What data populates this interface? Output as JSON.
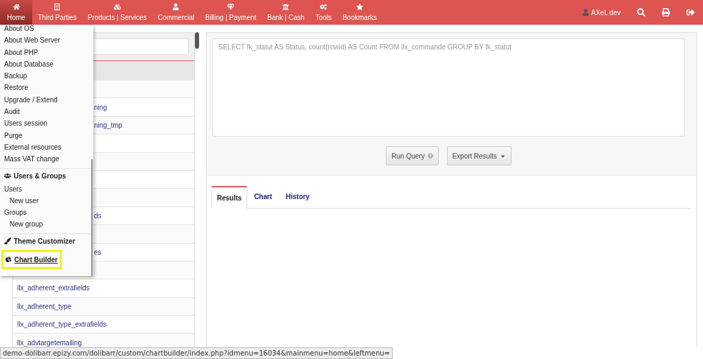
{
  "navbar": {
    "items": [
      {
        "label": "Home",
        "selected": true
      },
      {
        "label": "Third Parties",
        "selected": false
      },
      {
        "label": "Products | Services",
        "selected": false
      },
      {
        "label": "Commercial",
        "selected": false
      },
      {
        "label": "Billing | Payment",
        "selected": false
      },
      {
        "label": "Bank | Cash",
        "selected": false
      },
      {
        "label": "Tools",
        "selected": false
      },
      {
        "label": "Bookmarks",
        "selected": false
      }
    ],
    "user": "AXeL dev"
  },
  "home_menu": [
    {
      "kind": "item",
      "label": "About OS",
      "highlighted": false
    },
    {
      "kind": "item",
      "label": "About Web Server",
      "highlighted": false
    },
    {
      "kind": "item",
      "label": "About PHP",
      "highlighted": false
    },
    {
      "kind": "item",
      "label": "About Database",
      "highlighted": false
    },
    {
      "kind": "item",
      "label": "Backup",
      "highlighted": false
    },
    {
      "kind": "item",
      "label": "Restore",
      "highlighted": false
    },
    {
      "kind": "item",
      "label": "Upgrade / Extend",
      "highlighted": false
    },
    {
      "kind": "item",
      "label": "Audit",
      "highlighted": false
    },
    {
      "kind": "item",
      "label": "Users session",
      "highlighted": false
    },
    {
      "kind": "item",
      "label": "Purge",
      "highlighted": false
    },
    {
      "kind": "item",
      "label": "External resources",
      "highlighted": false
    },
    {
      "kind": "item",
      "label": "Mass VAT change",
      "highlighted": false
    },
    {
      "kind": "heading",
      "label": "Users & Groups",
      "highlighted": false
    },
    {
      "kind": "item",
      "label": "Users",
      "highlighted": false
    },
    {
      "kind": "subitem",
      "label": "New user",
      "highlighted": false
    },
    {
      "kind": "item",
      "label": "Groups",
      "highlighted": false
    },
    {
      "kind": "subitem",
      "label": "New group",
      "highlighted": false
    },
    {
      "kind": "heading",
      "label": "Theme Customizer",
      "highlighted": false
    },
    {
      "kind": "heading",
      "label": "Chart Builder",
      "highlighted": true
    }
  ],
  "tables_list": {
    "rows": [
      {
        "kind": "covered"
      },
      {
        "kind": "covered",
        "label": "ning"
      },
      {
        "kind": "covered",
        "label": "ning_tmp"
      },
      {
        "kind": "covered"
      },
      {
        "kind": "covered"
      },
      {
        "kind": "covered"
      },
      {
        "kind": "covered"
      },
      {
        "kind": "covered",
        "label": "ds"
      },
      {
        "kind": "covered"
      },
      {
        "kind": "covered",
        "label": "es"
      },
      {
        "kind": "covered"
      },
      {
        "kind": "full",
        "label": "llx_adherent_extrafields"
      },
      {
        "kind": "full",
        "label": "llx_adherent_type"
      },
      {
        "kind": "full",
        "label": "llx_adherent_type_extrafields"
      },
      {
        "kind": "full",
        "label": "llx_advtargetemailing"
      }
    ]
  },
  "query": {
    "placeholder": "SELECT fk_statut AS Status, count(rowid) AS Count FROM llx_commande GROUP BY fk_statut"
  },
  "buttons": {
    "run": "Run Query",
    "export": "Export Results"
  },
  "result_tabs": [
    {
      "label": "Results",
      "selected": true
    },
    {
      "label": "Chart",
      "selected": false
    },
    {
      "label": "History",
      "selected": false
    }
  ],
  "status_bar": "demo-dolibarr.epizy.com/dolibarr/custom/chartbuilder/index.php?idmenu=16034&mainmenu=home&leftmenu="
}
